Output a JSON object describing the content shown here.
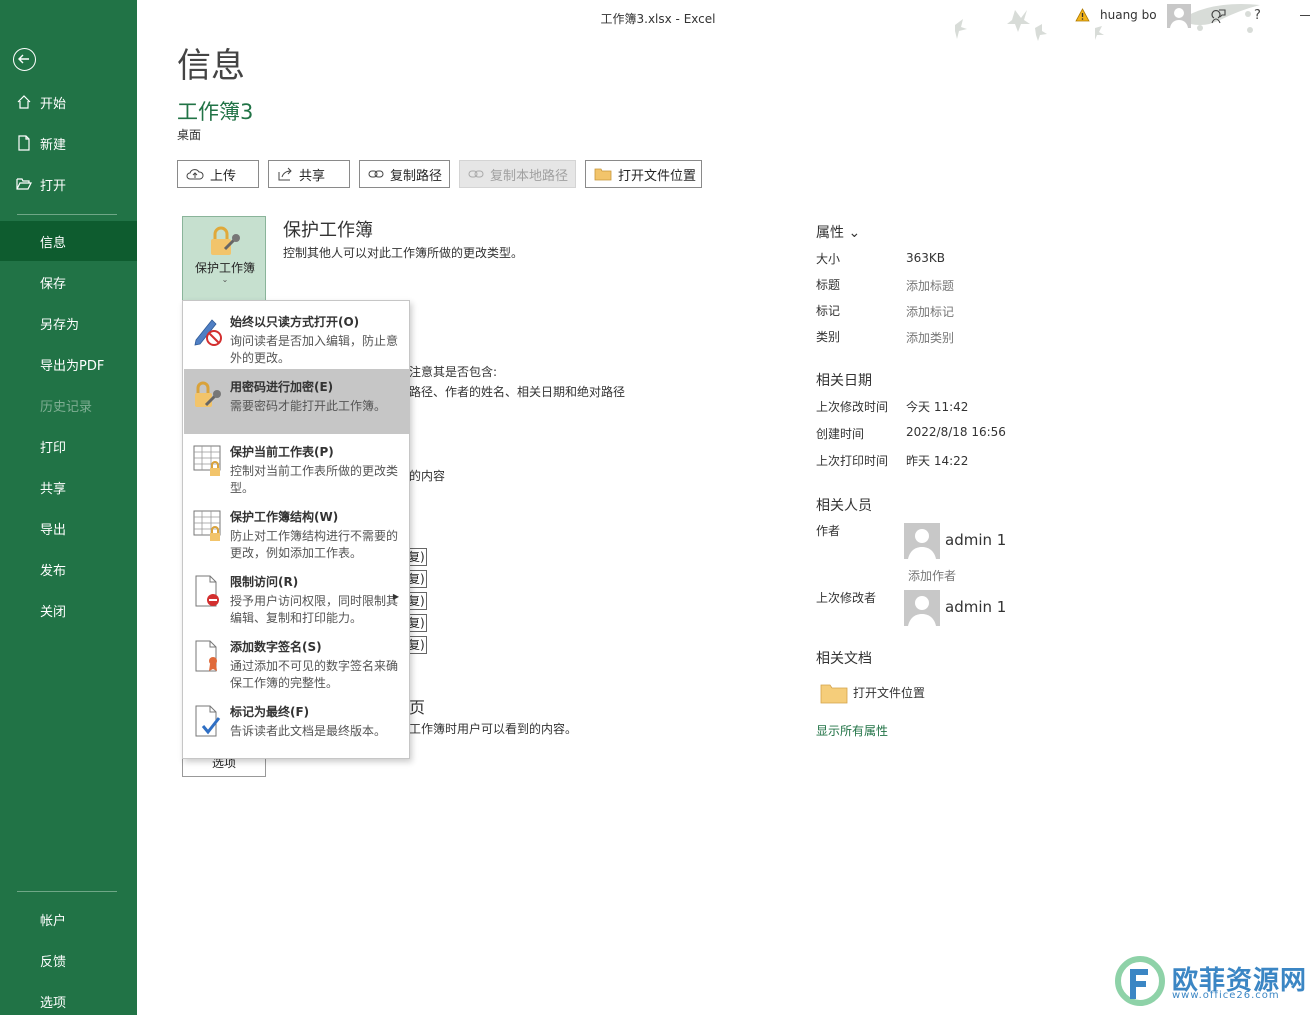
{
  "titlebar": {
    "text": "工作簿3.xlsx  -  Excel",
    "user": "huang bo",
    "help": "?"
  },
  "sidebar": {
    "items": [
      {
        "label": "开始"
      },
      {
        "label": "新建"
      },
      {
        "label": "打开"
      },
      {
        "label": "信息"
      },
      {
        "label": "保存"
      },
      {
        "label": "另存为"
      },
      {
        "label": "导出为PDF"
      },
      {
        "label": "历史记录"
      },
      {
        "label": "打印"
      },
      {
        "label": "共享"
      },
      {
        "label": "导出"
      },
      {
        "label": "发布"
      },
      {
        "label": "关闭"
      },
      {
        "label": "帐户"
      },
      {
        "label": "反馈"
      },
      {
        "label": "选项"
      }
    ]
  },
  "main": {
    "title": "信息",
    "doc_name": "工作簿3",
    "doc_location": "桌面",
    "toolbar": {
      "upload": "上传",
      "share": "共享",
      "copy_path": "复制路径",
      "copy_local_path": "复制本地路径",
      "open_location": "打开文件位置"
    },
    "protect": {
      "tile_label": "保护工作簿",
      "chevron": "⌄",
      "title": "保护工作簿",
      "desc": "控制其他人可以对此工作簿所做的更改类型。"
    },
    "background": {
      "inspect_line1": "注意其是否包含:",
      "inspect_line2": "路径、作者的姓名、相关日期和绝对路径",
      "inspect_line3": "的内容",
      "versions_heading": "页",
      "versions_desc": "工作簿时用户可以看到的内容。",
      "restore": "复)",
      "options": "选项"
    },
    "menu": [
      {
        "title": "始终以只读方式打开(O)",
        "desc": "询问读者是否加入编辑，防止意外的更改。"
      },
      {
        "title": "用密码进行加密(E)",
        "desc": "需要密码才能打开此工作簿。"
      },
      {
        "title": "保护当前工作表(P)",
        "desc": "控制对当前工作表所做的更改类型。"
      },
      {
        "title": "保护工作簿结构(W)",
        "desc": "防止对工作簿结构进行不需要的更改，例如添加工作表。"
      },
      {
        "title": "限制访问(R)",
        "desc": "授予用户访问权限，同时限制其编辑、复制和打印能力。"
      },
      {
        "title": "添加数字签名(S)",
        "desc": "通过添加不可见的数字签名来确保工作簿的完整性。"
      },
      {
        "title": "标记为最终(F)",
        "desc": "告诉读者此文档是最终版本。"
      }
    ]
  },
  "properties": {
    "heading": "属性 ⌄",
    "size_k": "大小",
    "size_v": "363KB",
    "title_k": "标题",
    "title_v": "添加标题",
    "tags_k": "标记",
    "tags_v": "添加标记",
    "category_k": "类别",
    "category_v": "添加类别",
    "dates_heading": "相关日期",
    "modified_k": "上次修改时间",
    "modified_v": "今天 11:42",
    "created_k": "创建时间",
    "created_v": "2022/8/18 16:56",
    "printed_k": "上次打印时间",
    "printed_v": "昨天 14:22",
    "people_heading": "相关人员",
    "author_k": "作者",
    "author_v": "admin 1",
    "add_author": "添加作者",
    "modifier_k": "上次修改者",
    "modifier_v": "admin 1",
    "docs_heading": "相关文档",
    "open_location": "打开文件位置",
    "show_all": "显示所有属性"
  },
  "watermark": {
    "text": "欧菲资源网",
    "url": "www.office26.com"
  },
  "colors": {
    "accent": "#217346",
    "sidebar_active": "#0e5c2f",
    "menu_hover": "#c6c6c6"
  }
}
